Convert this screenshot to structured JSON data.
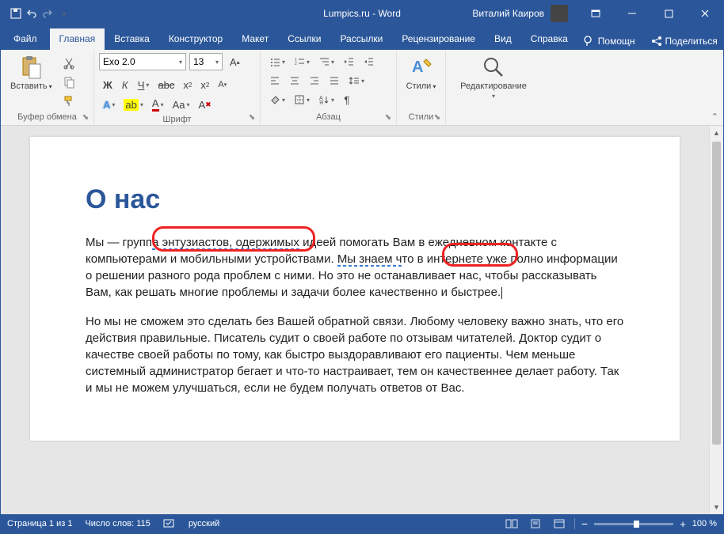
{
  "title_bar": {
    "doc_title": "Lumpics.ru - Word",
    "user_name": "Виталий Каиров"
  },
  "tabs": {
    "file": "Файл",
    "items": [
      "Главная",
      "Вставка",
      "Конструктор",
      "Макет",
      "Ссылки",
      "Рассылки",
      "Рецензирование",
      "Вид",
      "Справка"
    ],
    "active_index": 0,
    "help": "Помощн",
    "share": "Поделиться"
  },
  "ribbon": {
    "clipboard": {
      "label": "Буфер обмена",
      "paste": "Вставить"
    },
    "font": {
      "label": "Шрифт",
      "name": "Exo 2.0",
      "size": "13"
    },
    "paragraph": {
      "label": "Абзац"
    },
    "styles": {
      "label": "Стили",
      "btn": "Стили"
    },
    "editing": {
      "label": "",
      "btn": "Редактирование"
    }
  },
  "document": {
    "heading": "О нас",
    "p1_a": "Мы — групп",
    "p1_err1": "а энтузиастов, одержимых",
    "p1_b": " идеей помогать Вам в ежедневном контакте с компьютерами и мобильными устройствами. ",
    "p1_err2": "Мы знаем ч",
    "p1_c": "то в интернете уже полно информации о решении разного рода проблем с ними. Но это не останавливает нас, чтобы рассказывать Вам, как решать многие проблемы и задачи более качественно и быстрее.",
    "p2": "Но мы не сможем это сделать без Вашей обратной связи. Любому человеку важно знать, что его действия правильные. Писатель судит о своей работе по отзывам читателей. Доктор судит о качестве своей работы по тому, как быстро выздоравливают его пациенты. Чем меньше системный администратор бегает и что-то настраивает, тем он качественнее делает работу. Так и мы не можем улучшаться, если не будем получать ответов от Вас."
  },
  "statusbar": {
    "page": "Страница 1 из 1",
    "words": "Число слов: 115",
    "lang": "русский",
    "zoom": "100 %"
  }
}
